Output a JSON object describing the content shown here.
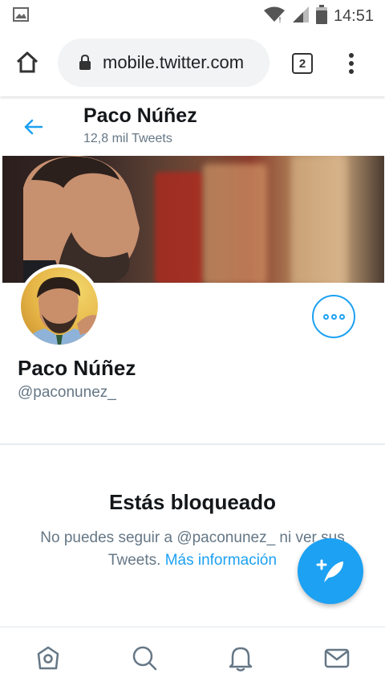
{
  "status_bar": {
    "time": "14:51",
    "icons": [
      "image-notification-icon",
      "wifi-icon",
      "signal-icon",
      "battery-icon"
    ]
  },
  "browser": {
    "url": "mobile.twitter.com",
    "tab_count": "2",
    "icons": [
      "home-icon",
      "lock-icon",
      "menu-dots-icon"
    ]
  },
  "profile_header": {
    "name": "Paco Núñez",
    "tweet_count": "12,8 mil Tweets"
  },
  "profile": {
    "name": "Paco Núñez",
    "handle": "@paconunez_"
  },
  "blocked": {
    "title": "Estás bloqueado",
    "message": "No puedes seguir a @paconunez_ ni ver sus Tweets.",
    "link": "Más información"
  },
  "nav": {
    "items": [
      "home-icon",
      "search-icon",
      "notifications-icon",
      "messages-icon"
    ]
  },
  "colors": {
    "accent": "#1da1f2",
    "secondary_text": "#657786"
  }
}
